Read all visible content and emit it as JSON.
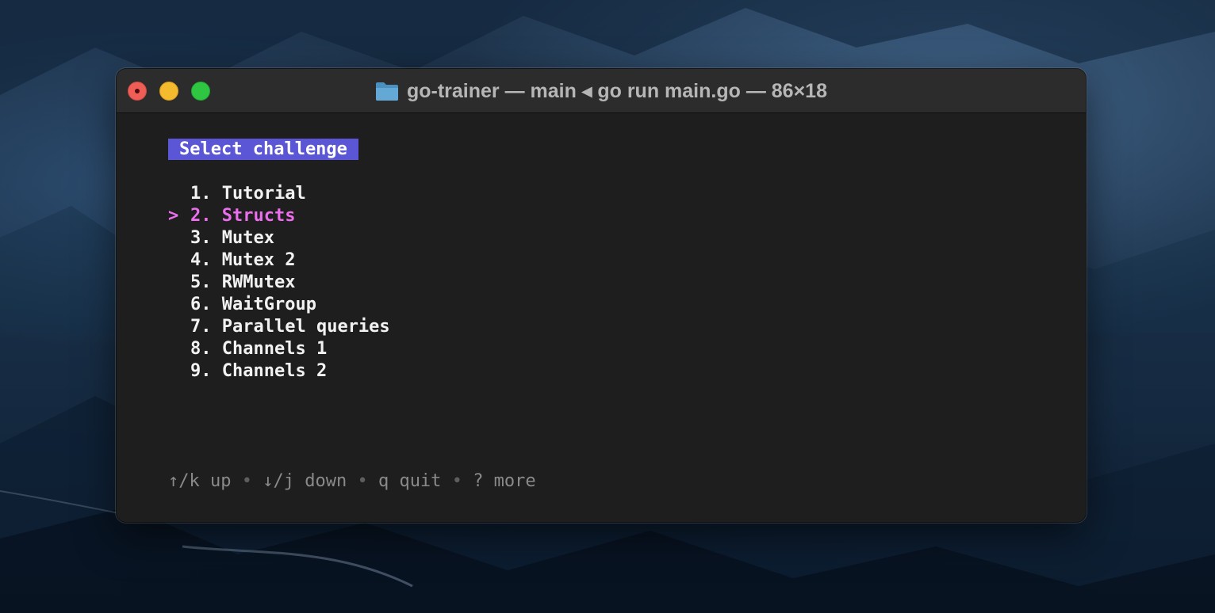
{
  "window": {
    "title": "go-trainer — main ◂ go run main.go — 86×18"
  },
  "colors": {
    "badge_bg": "#5a56d6",
    "selected_fg": "#ec6ded",
    "terminal_bg": "#1e1e1e",
    "help_fg": "#8a8a8a"
  },
  "header": {
    "label": "Select challenge"
  },
  "menu": {
    "cursor": ">",
    "selected_index": 1,
    "items": [
      {
        "number": "1.",
        "label": "Tutorial"
      },
      {
        "number": "2.",
        "label": "Structs"
      },
      {
        "number": "3.",
        "label": "Mutex"
      },
      {
        "number": "4.",
        "label": "Mutex 2"
      },
      {
        "number": "5.",
        "label": "RWMutex"
      },
      {
        "number": "6.",
        "label": "WaitGroup"
      },
      {
        "number": "7.",
        "label": "Parallel queries"
      },
      {
        "number": "8.",
        "label": "Channels 1"
      },
      {
        "number": "9.",
        "label": "Channels 2"
      }
    ]
  },
  "help": {
    "up": "↑/k up",
    "down": "↓/j down",
    "quit": "q quit",
    "more": "? more",
    "separator": "•"
  }
}
